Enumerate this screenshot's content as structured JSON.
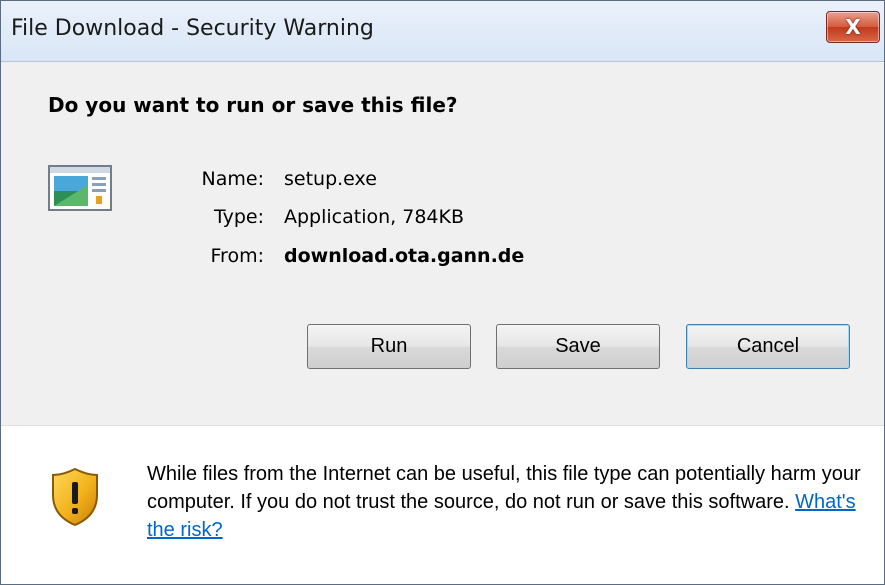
{
  "window": {
    "title": "File Download - Security Warning",
    "close_label": "X"
  },
  "dialog": {
    "question": "Do you want to run or save this file?",
    "file": {
      "name_label": "Name:",
      "name_value": "setup.exe",
      "type_label": "Type:",
      "type_value": "Application, 784KB",
      "from_label": "From:",
      "from_value": "download.ota.gann.de",
      "icon": "application-file-icon"
    },
    "buttons": {
      "run": "Run",
      "save": "Save",
      "cancel": "Cancel"
    }
  },
  "footer": {
    "icon": "security-shield-icon",
    "warning_text": "While files from the Internet can be useful, this file type can potentially harm your computer. If you do not trust the source, do not run or save this software.",
    "risk_link": "What's the risk?"
  },
  "colors": {
    "link": "#0066cc",
    "close_button": "#c2391b",
    "shield_yellow": "#f2b21c"
  }
}
